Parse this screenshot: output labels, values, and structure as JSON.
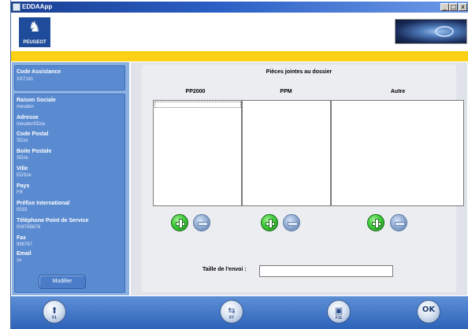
{
  "window": {
    "title": "EDDAApp",
    "minimize_glyph": "_",
    "maximize_glyph": "□",
    "close_glyph": "x"
  },
  "header": {
    "logo_text": "PEUGEOT",
    "logo_icon": "lion-icon",
    "banner_icon": "brand-banner-image",
    "accent_yellow": "#fcd014"
  },
  "sidebar": {
    "code_label": "Code Assistance",
    "code_value": "XX7161",
    "fields": [
      {
        "label": "Raison Sociale",
        "value": "meudon"
      },
      {
        "label": "Adresse",
        "value": "meudonSDze"
      },
      {
        "label": "Code Postal",
        "value": "SDze"
      },
      {
        "label": "Boite Postale",
        "value": "SDze"
      },
      {
        "label": "Ville",
        "value": "EDSze"
      },
      {
        "label": "Pays",
        "value": "FR"
      },
      {
        "label": "Préfixe International",
        "value": "0033"
      },
      {
        "label": "Téléphone Point de Service",
        "value": "009785678"
      },
      {
        "label": "Fax",
        "value": "998767"
      },
      {
        "label": "Email",
        "value": "ze"
      }
    ],
    "modify_label": "Modifier"
  },
  "main": {
    "title": "Pièces jointes au dossier",
    "columns": [
      {
        "label": "PP2000"
      },
      {
        "label": "PPM"
      },
      {
        "label": "Autre"
      }
    ],
    "size_label": "Taille de l'envoi :",
    "size_value": ""
  },
  "footer": {
    "keys": [
      {
        "icon": "arrow-up-icon",
        "label": "F1"
      },
      {
        "icon": "document-swap-icon",
        "label": "F7"
      },
      {
        "icon": "monitor-icon",
        "label": "F11"
      },
      {
        "icon": "ok-icon",
        "label": "OK"
      }
    ]
  }
}
